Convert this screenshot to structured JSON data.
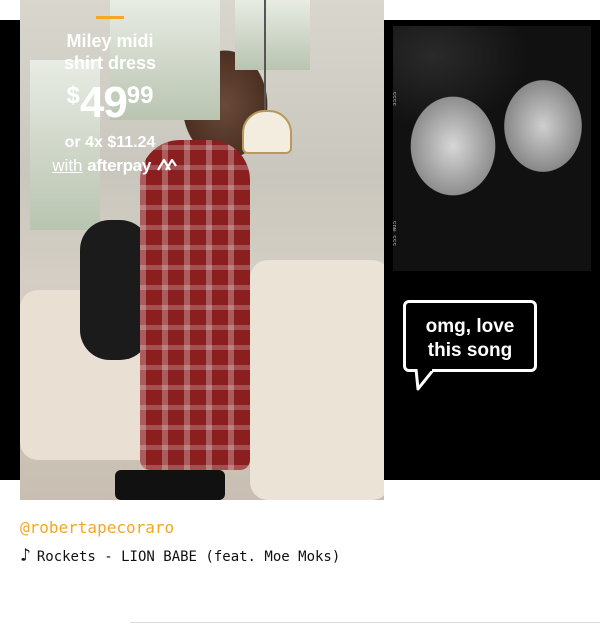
{
  "product": {
    "name_line1": "Miley midi",
    "name_line2": "shirt dress",
    "price_currency": "$",
    "price_whole": "49",
    "price_cents": "99",
    "installment": "or 4x $11.24",
    "afterpay_with": "with",
    "afterpay_brand": "afterpay"
  },
  "speech_bubble": {
    "line1": "omg, love",
    "line2": "this song"
  },
  "caption": {
    "handle": "@robertapecoraro",
    "note_icon": "music-note-icon",
    "song": "Rockets - LION BABE (feat. Moe Moks)"
  },
  "colors": {
    "accent": "#f5a623",
    "band": "#000000",
    "text_light": "#ffffff"
  }
}
